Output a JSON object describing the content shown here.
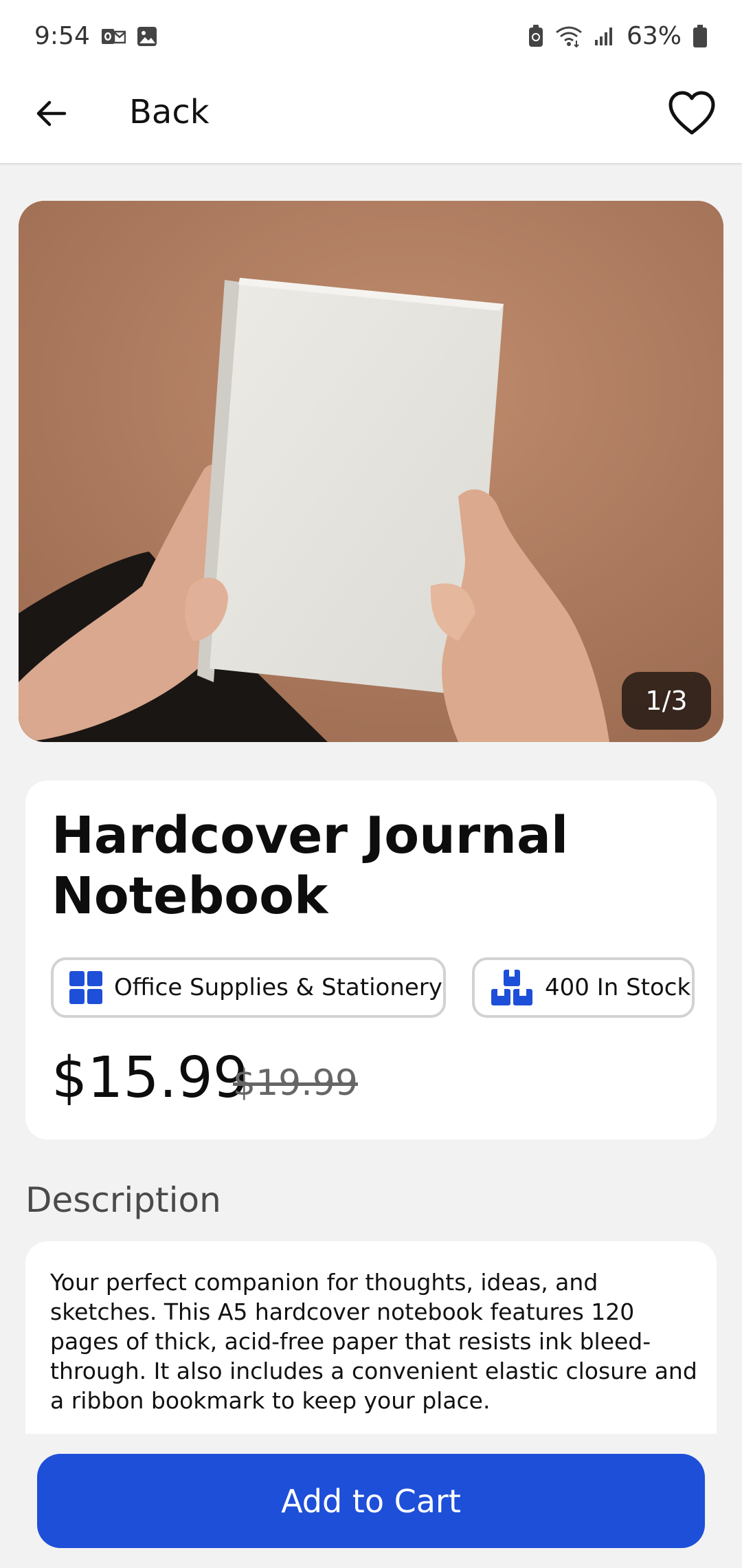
{
  "status_bar": {
    "time": "9:54",
    "battery": "63%",
    "icons": [
      "outlook-icon",
      "image-icon",
      "battery-saver-icon",
      "wifi-icon",
      "signal-icon",
      "battery-icon"
    ]
  },
  "app_bar": {
    "back_label": "Back",
    "icons": [
      "back-arrow-icon",
      "heart-icon"
    ]
  },
  "gallery": {
    "counter": "1/3"
  },
  "product": {
    "title": "Hardcover Journal Notebook",
    "category": "Office Supplies & Stationery",
    "stock": "400 In Stock",
    "price": "$15.99",
    "original_price": "$19.99",
    "accent_color": "#1e4fd8"
  },
  "description": {
    "heading": "Description",
    "text": "Your perfect companion for thoughts, ideas, and sketches. This A5 hardcover notebook features 120 pages of thick, acid-free paper that resists ink bleed-through. It also includes a convenient elastic closure and a ribbon bookmark to keep your place."
  },
  "actions": {
    "add_to_cart": "Add to Cart"
  }
}
